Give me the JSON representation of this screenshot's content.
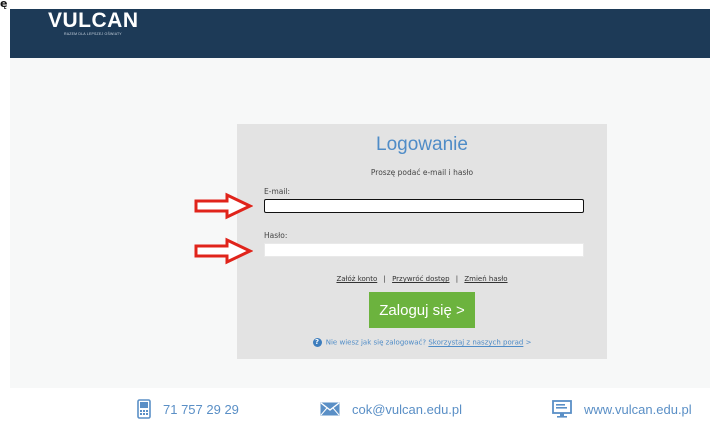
{
  "corner_text": "ę",
  "header": {
    "logo_text": "VULCAN",
    "logo_tagline": "RAZEM DLA LEPSZEJ OŚWIATY"
  },
  "login": {
    "title": "Logowanie",
    "subtitle": "Proszę podać e-mail i hasło",
    "email_label": "E-mail:",
    "email_value": "",
    "password_label": "Hasło:",
    "password_value": "",
    "links": {
      "register": "Załóż konto",
      "separator": "|",
      "restore_access": "Przywróć dostęp",
      "change_password": "Zmień hasło"
    },
    "submit_label": "Zaloguj się >",
    "help": {
      "question": "Nie wiesz jak się zalogować?",
      "link": "Skorzystaj z naszych porad",
      "suffix": ">"
    }
  },
  "annotations": {
    "arrow_color": "#e0241b"
  },
  "footer": {
    "phone": "71 757 29 29",
    "email": "cok@vulcan.edu.pl",
    "website": "www.vulcan.edu.pl"
  },
  "colors": {
    "header_bg": "#1d3a57",
    "panel_bg": "#e3e3e3",
    "title_blue": "#4f8cc7",
    "button_green": "#6cb33e"
  }
}
